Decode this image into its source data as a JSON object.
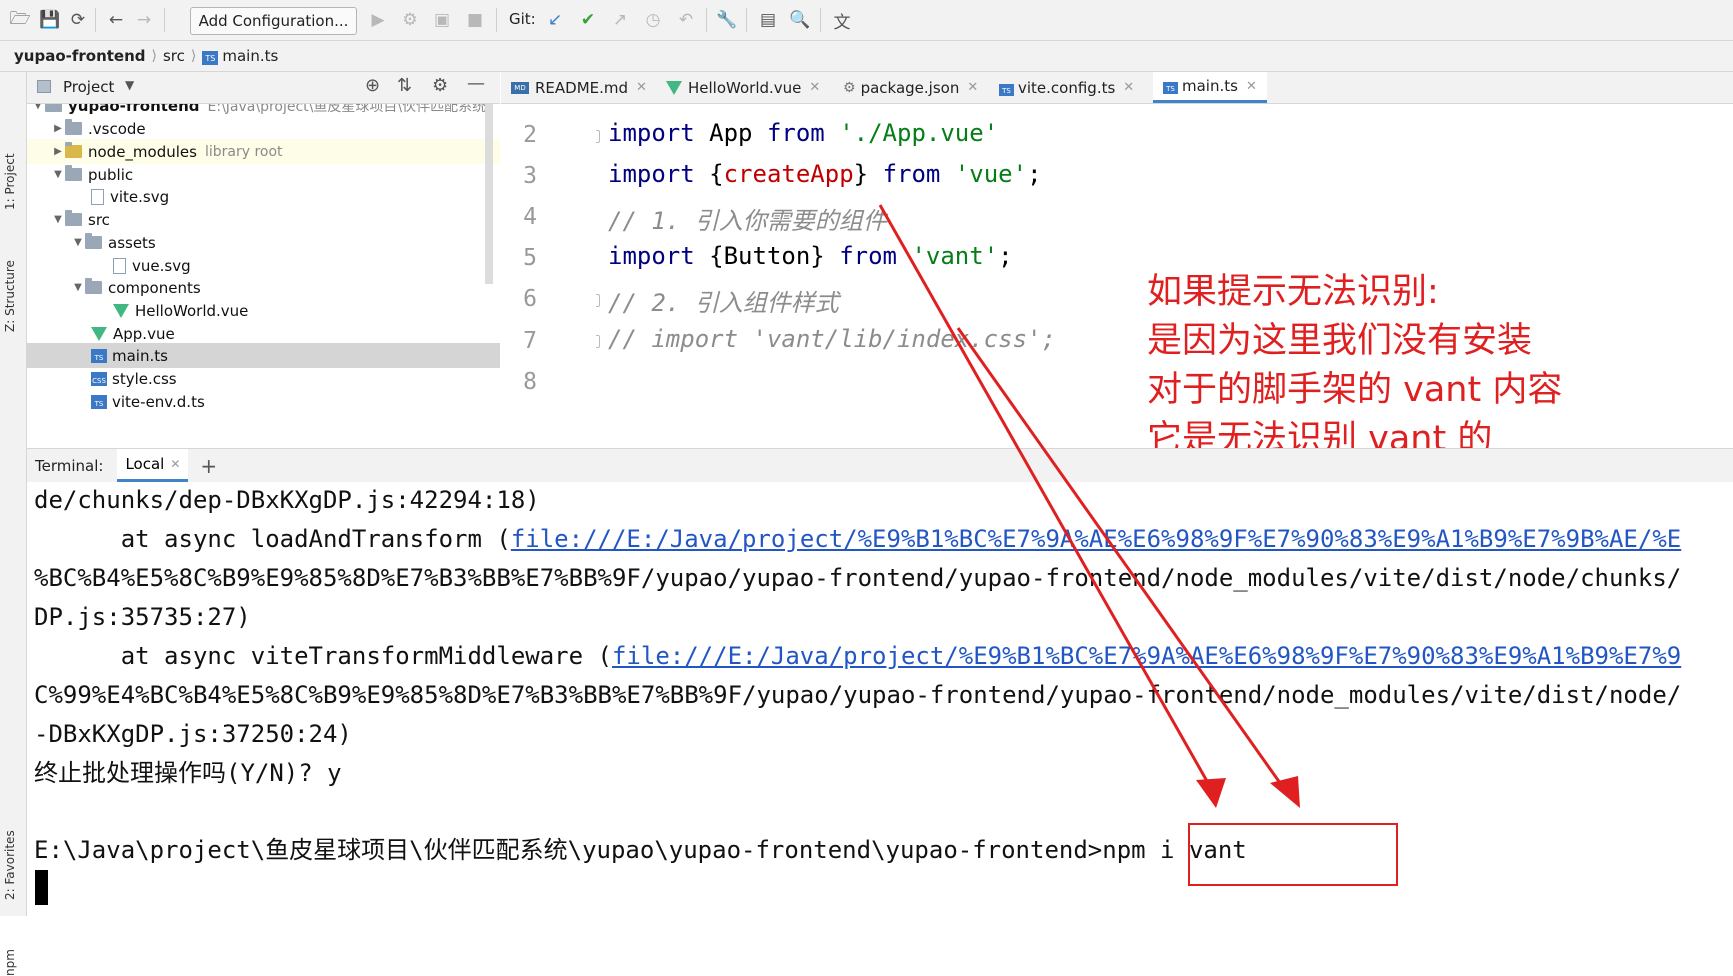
{
  "toolbar": {
    "add_configuration": "Add Configuration...",
    "git_label": "Git:",
    "icons": [
      "open-icon",
      "save-icon",
      "sync-icon",
      "back-icon",
      "forward-icon",
      "run-icon",
      "debug-icon",
      "coverage-icon",
      "stop-icon",
      "git-update-icon",
      "git-commit-icon",
      "git-push-icon",
      "git-history-icon",
      "git-rollback-icon",
      "settings-wrench-icon",
      "project-structure-icon",
      "search-icon",
      "translate-icon"
    ]
  },
  "breadcrumb": {
    "project": "yupao-frontend",
    "folder": "src",
    "file": "main.ts",
    "file_badge": "TS"
  },
  "left_stripe": {
    "project_tab": "1: Project",
    "structure_tab": "Z: Structure",
    "favorites_tab": "2: Favorites",
    "npm_tab": "npm"
  },
  "project_panel": {
    "title": "Project",
    "tree": [
      {
        "label": "yupao-frontend",
        "extra": "E:\\Java\\project\\鱼皮星球项目\\伙伴匹配系统",
        "type": "folder",
        "expanded": true
      },
      {
        "label": ".vscode",
        "extra": "",
        "type": "folder",
        "expanded": false
      },
      {
        "label": "node_modules",
        "extra": "library root",
        "type": "folder",
        "expanded": false
      },
      {
        "label": "public",
        "extra": "",
        "type": "folder",
        "expanded": true
      },
      {
        "label": "vite.svg",
        "extra": "",
        "type": "file"
      },
      {
        "label": "src",
        "extra": "",
        "type": "folder",
        "expanded": true
      },
      {
        "label": "assets",
        "extra": "",
        "type": "folder",
        "expanded": true
      },
      {
        "label": "vue.svg",
        "extra": "",
        "type": "file"
      },
      {
        "label": "components",
        "extra": "",
        "type": "folder",
        "expanded": true
      },
      {
        "label": "HelloWorld.vue",
        "extra": "",
        "type": "vue"
      },
      {
        "label": "App.vue",
        "extra": "",
        "type": "vue"
      },
      {
        "label": "main.ts",
        "extra": "",
        "type": "ts"
      },
      {
        "label": "style.css",
        "extra": "",
        "type": "css"
      },
      {
        "label": "vite-env.d.ts",
        "extra": "",
        "type": "ts"
      }
    ]
  },
  "editor": {
    "tabs": [
      {
        "label": "README.md",
        "badge": "MD"
      },
      {
        "label": "HelloWorld.vue",
        "badge": ""
      },
      {
        "label": "package.json",
        "badge": ""
      },
      {
        "label": "vite.config.ts",
        "badge": "TS"
      },
      {
        "label": "main.ts",
        "badge": "TS"
      }
    ],
    "line_numbers": [
      "2",
      "3",
      "4",
      "5",
      "6",
      "7",
      "8"
    ],
    "lines": {
      "l2": {
        "kw": "import",
        "mid": " App ",
        "kw2": "from",
        "str": " './App.vue'"
      },
      "l3": {
        "kw": "import",
        "a": " {",
        "fn": "createApp",
        "b": "} ",
        "kw2": "from",
        "str": " 'vue'",
        "end": ";"
      },
      "l4": {
        "cm": "// 1. 引入你需要的组件"
      },
      "l5": {
        "kw": "import",
        "a": " {Button} ",
        "kw2": "from",
        "str": " 'vant'",
        "end": ";"
      },
      "l6": {
        "cm": "// 2. 引入组件样式"
      },
      "l7": {
        "cm": "// import 'vant/lib/index.css';"
      }
    }
  },
  "annotation": {
    "line1": "如果提示无法识别:",
    "line2": "是因为这里我们没有安装",
    "line3": "对于的脚手架的 vant 内容",
    "line4": "它是无法识别 vant 的"
  },
  "terminal": {
    "label": "Terminal:",
    "tab": "Local",
    "lines": {
      "t1": "de/chunks/dep-DBxKXgDP.js:42294:18)",
      "t2a": "      at async loadAndTransform (",
      "t2b": "file:///E:/Java/project/%E9%B1%BC%E7%9A%AE%E6%98%9F%E7%90%83%E9%A1%B9%E7%9B%AE/%E",
      "t3": "%BC%B4%E5%8C%B9%E9%85%8D%E7%B3%BB%E7%BB%9F/yupao/yupao-frontend/yupao-frontend/node_modules/vite/dist/node/chunks/",
      "t4": "DP.js:35735:27)",
      "t5a": "      at async viteTransformMiddleware (",
      "t5b": "file:///E:/Java/project/%E9%B1%BC%E7%9A%AE%E6%98%9F%E7%90%83%E9%A1%B9%E7%9",
      "t6": "C%99%E4%BC%B4%E5%8C%B9%E9%85%8D%E7%B3%BB%E7%BB%9F/yupao/yupao-frontend/yupao-frontend/node_modules/vite/dist/node/",
      "t7": "-DBxKXgDP.js:37250:24)",
      "t8": "终止批处理操作吗(Y/N)? y",
      "t9": "E:\\Java\\project\\鱼皮星球项目\\伙伴匹配系统\\yupao\\yupao-frontend\\yupao-frontend>npm i vant",
      "t10": "\\"
    }
  },
  "colors": {
    "annotation": "#e02020",
    "link": "#2156c4",
    "keyword": "#000080",
    "string": "#067d17"
  }
}
